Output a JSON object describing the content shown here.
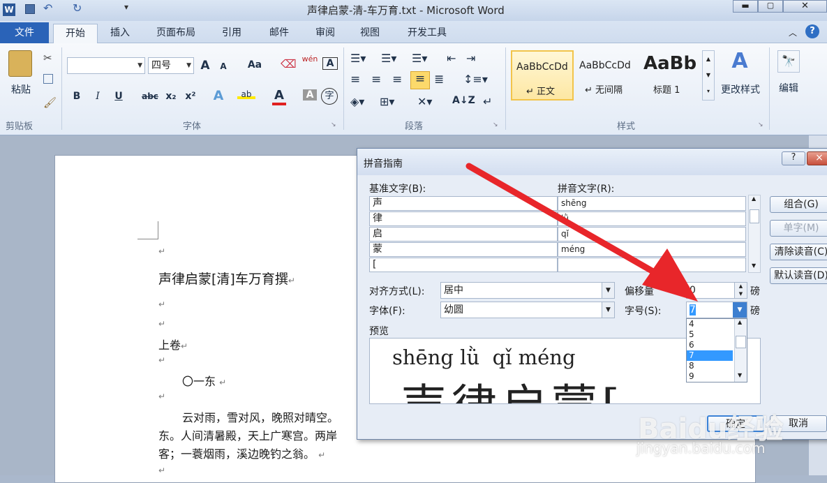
{
  "window": {
    "title": "声律启蒙-清-车万育.txt - Microsoft Word"
  },
  "tabs": [
    "文件",
    "开始",
    "插入",
    "页面布局",
    "引用",
    "邮件",
    "审阅",
    "视图",
    "开发工具"
  ],
  "ribbon": {
    "clipboard": {
      "paste": "粘贴",
      "group": "剪贴板"
    },
    "font": {
      "font_name": "",
      "font_size": "四号",
      "group": "字体",
      "grow": "A",
      "shrink": "A",
      "change_case": "Aa",
      "bold": "B",
      "italic": "I",
      "underline": "U",
      "strike": "abc",
      "subscript": "x₂",
      "superscript": "x²",
      "font_color": "A",
      "char_shade": "A",
      "enclose": "字",
      "pinyin": "wén",
      "border": "A"
    },
    "paragraph": {
      "group": "段落"
    },
    "styles": {
      "group": "样式",
      "items": [
        {
          "preview": "AaBbCcDd",
          "name": "↵ 正文"
        },
        {
          "preview": "AaBbCcDd",
          "name": "↵ 无间隔"
        },
        {
          "preview": "AaBb",
          "name": "标题 1"
        }
      ],
      "change_styles": "更改样式"
    },
    "editing": {
      "label": "编辑"
    }
  },
  "document": {
    "title": "声律启蒙[清]车万育撰",
    "vol": "上卷",
    "section": "〇一东",
    "line1": "云对雨，雪对风，晚照对晴空。",
    "line2": "东。人间清暑殿，天上广寒宫。两岸",
    "line3": "客；一蓑烟雨，溪边晚钓之翁。",
    "ret": "↵"
  },
  "dialog": {
    "title": "拼音指南",
    "base_label": "基准文字(B):",
    "ruby_label": "拼音文字(R):",
    "rows": [
      {
        "base": "声",
        "ruby": "shēng"
      },
      {
        "base": "律",
        "ruby": "lǜ"
      },
      {
        "base": "启",
        "ruby": "qǐ"
      },
      {
        "base": "蒙",
        "ruby": "méng"
      },
      {
        "base": "[",
        "ruby": ""
      }
    ],
    "align_label": "对齐方式(L):",
    "align_value": "居中",
    "font_label": "字体(F):",
    "font_value": "幼圆",
    "offset_label": "偏移量",
    "offset_value": "0",
    "offset_unit": "磅",
    "size_label": "字号(S):",
    "size_value": "7",
    "size_unit": "磅",
    "size_options": [
      "4",
      "5",
      "6",
      "7",
      "8",
      "9"
    ],
    "size_selected": "7",
    "preview_label": "预览",
    "preview_ruby": "shēng lǜ  qǐ méng",
    "preview_base": "声律启蒙[",
    "buttons": {
      "group": "组合(G)",
      "mono": "单字(M)",
      "clear": "清除读音(C)",
      "default": "默认读音(D)",
      "ok": "确定",
      "cancel": "取消"
    },
    "help": "?",
    "close": "×"
  },
  "watermark": {
    "text": "Baidu经验",
    "url": "jingyan.baidu.com"
  }
}
